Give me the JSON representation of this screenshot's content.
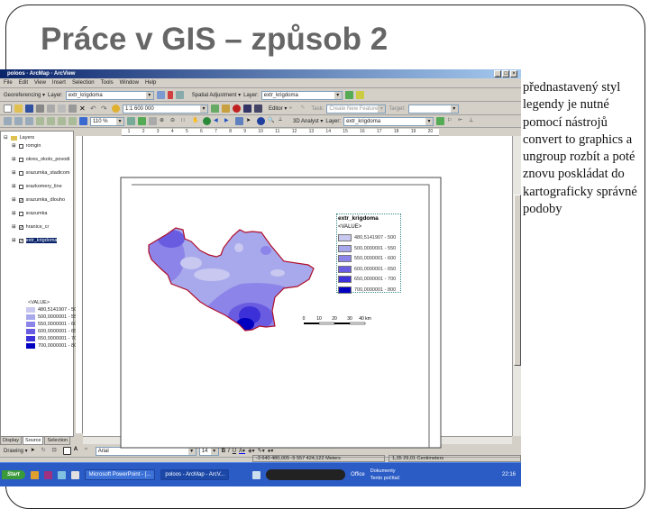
{
  "slide": {
    "title": "Práce v GIS – způsob 2",
    "note": "přednastavený styl legendy je nutné pomocí nástrojů convert to graphics a ungroup rozbít a poté znovu poskládat do kartograficky správné podoby"
  },
  "window": {
    "title": "poloos · ArcMap · ArcView",
    "buttons": [
      "_",
      "□",
      "×"
    ]
  },
  "menu": [
    "File",
    "Edit",
    "View",
    "Insert",
    "Selection",
    "Tools",
    "Window",
    "Help"
  ],
  "toolbars": {
    "georef_label": "Georeferencing ▾",
    "layer_label": "Layer:",
    "layer_value": "extr_krigdoma",
    "spatial_label": "Spatial Adjustment ▾",
    "spatial_layer_label": "Layer:",
    "spatial_layer_value": "extr_krigdoma",
    "scale_value": "1:1 600 000",
    "editor_label": "Editor ▾",
    "task_label": "Task:",
    "task_value": "Create New Feature",
    "target_label": "Target:",
    "zoom_value": "110 %",
    "analyst_label": "3D Analyst ▾",
    "analyst_layer_label": "Layer:",
    "analyst_layer_value": "extr_krigdoma"
  },
  "ruler_ticks": [
    "1",
    "2",
    "3",
    "4",
    "5",
    "6",
    "7",
    "8",
    "9",
    "10",
    "11",
    "12",
    "13",
    "14",
    "15",
    "16",
    "17",
    "18",
    "19",
    "20"
  ],
  "toc": {
    "root": "Layers",
    "layers": [
      {
        "name": "romgin",
        "checked": false
      },
      {
        "name": "okres_okolo_povodi",
        "checked": false
      },
      {
        "name": "srazumka_stadicom",
        "checked": false
      },
      {
        "name": "srazkomery_line",
        "checked": false
      },
      {
        "name": "srazumka_dlouho",
        "checked": true
      },
      {
        "name": "srazumka",
        "checked": false
      },
      {
        "name": "hranice_cr",
        "checked": true
      },
      {
        "name": "extr_krigdoma",
        "checked": true,
        "selected": true
      }
    ],
    "value_label": "<VALUE>",
    "classes": [
      {
        "label": "480,5141907 - 500",
        "color": "#c8c8f0"
      },
      {
        "label": "500,0000001 - 550",
        "color": "#a8a8ec"
      },
      {
        "label": "550,0000001 - 600",
        "color": "#8c84e8"
      },
      {
        "label": "600,0000001 - 650",
        "color": "#6a5ce0"
      },
      {
        "label": "650,0000001 - 700",
        "color": "#3c30d8"
      },
      {
        "label": "700,0000001 - 800",
        "color": "#0000c0"
      }
    ]
  },
  "legend": {
    "title": "extr_krigdoma",
    "field": "<VALUE>"
  },
  "scalebar": {
    "labels": [
      "0",
      "10",
      "20",
      "30",
      "40 km"
    ]
  },
  "tabs": [
    "Display",
    "Source",
    "Selection"
  ],
  "drawing": {
    "label": "Drawing ▾",
    "font": "Arial",
    "size": "14",
    "bold": "B",
    "italic": "I",
    "underline": "U"
  },
  "status": {
    "coords": "-3 640 480,005 -5 557 424,122 Meters",
    "page": "1,35 29,01 Centimeters"
  },
  "taskbar": {
    "start": "Start",
    "tasks": [
      "Microsoft PowerPoint - [...",
      "poloos - ArcMap - ArcV..."
    ],
    "office": "Office",
    "folders": [
      "Dokumenty",
      "Tento počítač"
    ],
    "time": "22:16"
  },
  "colors": {
    "boundary": "#b0102a",
    "titlebar": "#0a246a",
    "taskbar": "#2b5cc6"
  }
}
